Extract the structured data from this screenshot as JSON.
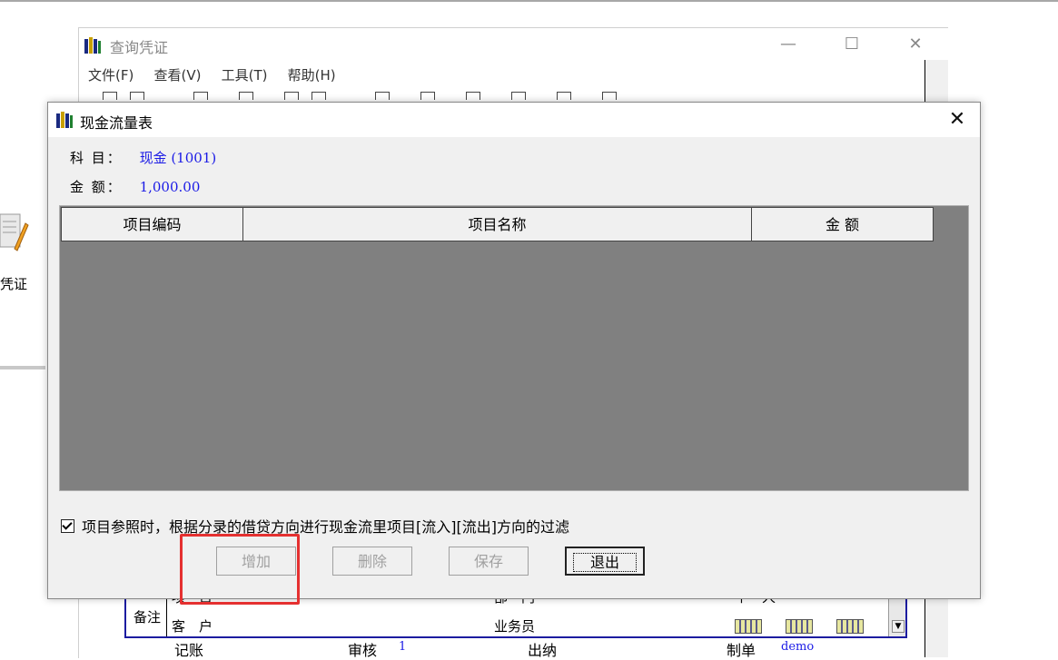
{
  "background_window": {
    "title": "查询凭证",
    "menu": [
      "文件(F)",
      "查看(V)",
      "工具(T)",
      "帮助(H)"
    ],
    "controls": {
      "minimize": "—",
      "maximize": "☐",
      "close": "✕"
    },
    "form": {
      "remark_label": "备注",
      "row1": {
        "item_label": "项　目",
        "dept_label": "部　门",
        "person_label": "个　人"
      },
      "row2": {
        "customer_label": "客　户",
        "salesman_label": "业务员"
      }
    },
    "footer": {
      "posting_label": "记账",
      "review_label": "审核",
      "review_value": "1",
      "cashier_label": "出纳",
      "maker_label": "制单",
      "maker_value": "demo"
    }
  },
  "side_icon": {
    "label": "凭证"
  },
  "dialog": {
    "title": "现金流量表",
    "close": "✕",
    "subject_label": "科 目：",
    "subject_value": "现金 (1001)",
    "amount_label": "金 额：",
    "amount_value": "1,000.00",
    "table": {
      "columns": [
        "项目编码",
        "项目名称",
        "金 额"
      ],
      "rows": []
    },
    "filter_checkbox": {
      "checked": true,
      "label": "项目参照时，根据分录的借贷方向进行现金流里项目[流入][流出]方向的过滤"
    },
    "buttons": {
      "add": "增加",
      "delete": "删除",
      "save": "保存",
      "exit": "退出"
    }
  },
  "colors": {
    "highlight": "#e53030",
    "value_text": "#1a1ae6",
    "grid_background": "#808080"
  }
}
